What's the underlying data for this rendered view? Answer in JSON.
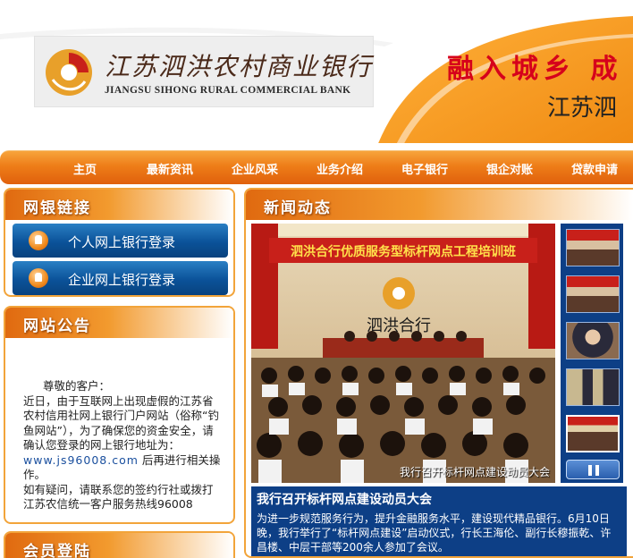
{
  "header": {
    "bank_name_cn": "江苏泗洪农村商业银行",
    "bank_name_en": "JIANGSU SIHONG RURAL COMMERCIAL BANK",
    "slogan": "融入城乡  成",
    "sub_slogan": "江苏泗"
  },
  "nav": {
    "items": [
      {
        "label": "主页"
      },
      {
        "label": "最新资讯"
      },
      {
        "label": "企业风采"
      },
      {
        "label": "业务介绍"
      },
      {
        "label": "电子银行"
      },
      {
        "label": "银企对账"
      },
      {
        "label": "贷款申请"
      }
    ]
  },
  "online_banking": {
    "title": "网银链接",
    "personal_label": "个人网上银行登录",
    "corporate_label": "企业网上银行登录"
  },
  "notice": {
    "title": "网站公告",
    "greeting": "尊敬的客户：",
    "paragraph1_pre": "近日，由于互联网上出现虚假的江苏省农村信用社网上银行门户网站（俗称“钓鱼网站”），为了确保您的资金安全，请确认您登录的网上银行地址为：",
    "url": "www.js96008.com",
    "paragraph1_post": "后再进行相关操作。",
    "paragraph2": "如有疑问，请联系您的签约行社或拨打江苏农信统一客户服务热线96008"
  },
  "member": {
    "title": "会员登陆"
  },
  "news": {
    "title": "新闻动态",
    "photo_banner_text": "泗洪合行优质服务型标杆网点工程培训班",
    "photo_logo_text": "泗洪合行",
    "photo_caption": "我行召开标杆网点建设动员大会",
    "headline": "我行召开标杆网点建设动员大会",
    "summary": "为进一步规范服务行为，提升金融服务水平，建设现代精品银行。6月10日晚，我行举行了“标杆网点建设”启动仪式，行长王海伦、副行长穆振乾、许昌楼、中层干部等200余人参加了会议。"
  },
  "colors": {
    "nav_orange": "#ee7d18",
    "panel_border": "#f2a43a",
    "news_blue": "#0d3f86",
    "slogan_red": "#d6001b"
  }
}
